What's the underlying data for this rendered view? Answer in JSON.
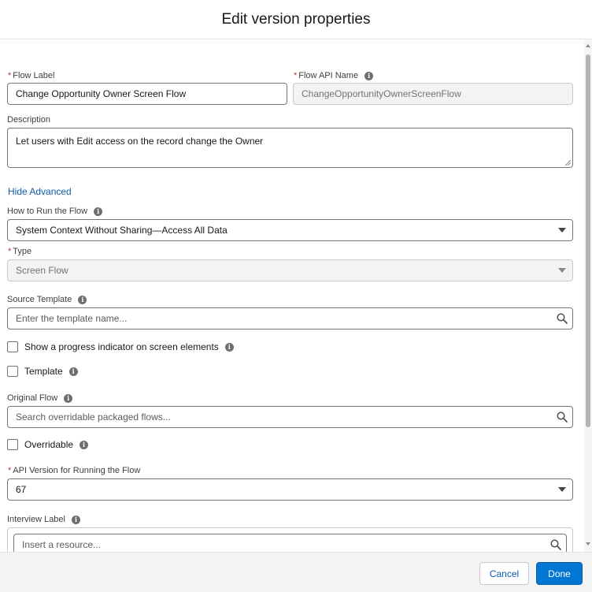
{
  "modal": {
    "title": "Edit version properties"
  },
  "form": {
    "flow_label": {
      "label": "Flow Label",
      "value": "Change Opportunity Owner Screen Flow"
    },
    "api_name": {
      "label": "Flow API Name",
      "value": "ChangeOpportunityOwnerScreenFlow"
    },
    "description": {
      "label": "Description",
      "value": "Let users with Edit access on the record change the Owner"
    },
    "advanced_toggle": "Hide Advanced",
    "run_mode": {
      "label": "How to Run the Flow",
      "value": "System Context Without Sharing—Access All Data"
    },
    "type": {
      "label": "Type",
      "value": "Screen Flow"
    },
    "source_template": {
      "label": "Source Template",
      "placeholder": "Enter the template name..."
    },
    "progress_indicator": {
      "label": "Show a progress indicator on screen elements",
      "checked": false
    },
    "template": {
      "label": "Template",
      "checked": false
    },
    "original_flow": {
      "label": "Original Flow",
      "placeholder": "Search overridable packaged flows..."
    },
    "overridable": {
      "label": "Overridable",
      "checked": false
    },
    "api_version": {
      "label": "API Version for Running the Flow",
      "value": "67"
    },
    "interview_label": {
      "label": "Interview Label",
      "placeholder": "Insert a resource..."
    },
    "required_mark": "*",
    "info_glyph": "i"
  },
  "footer": {
    "cancel_label": "Cancel",
    "done_label": "Done"
  },
  "colors": {
    "brand": "#0176d3",
    "link": "#0b5cab",
    "required": "#c23934"
  }
}
